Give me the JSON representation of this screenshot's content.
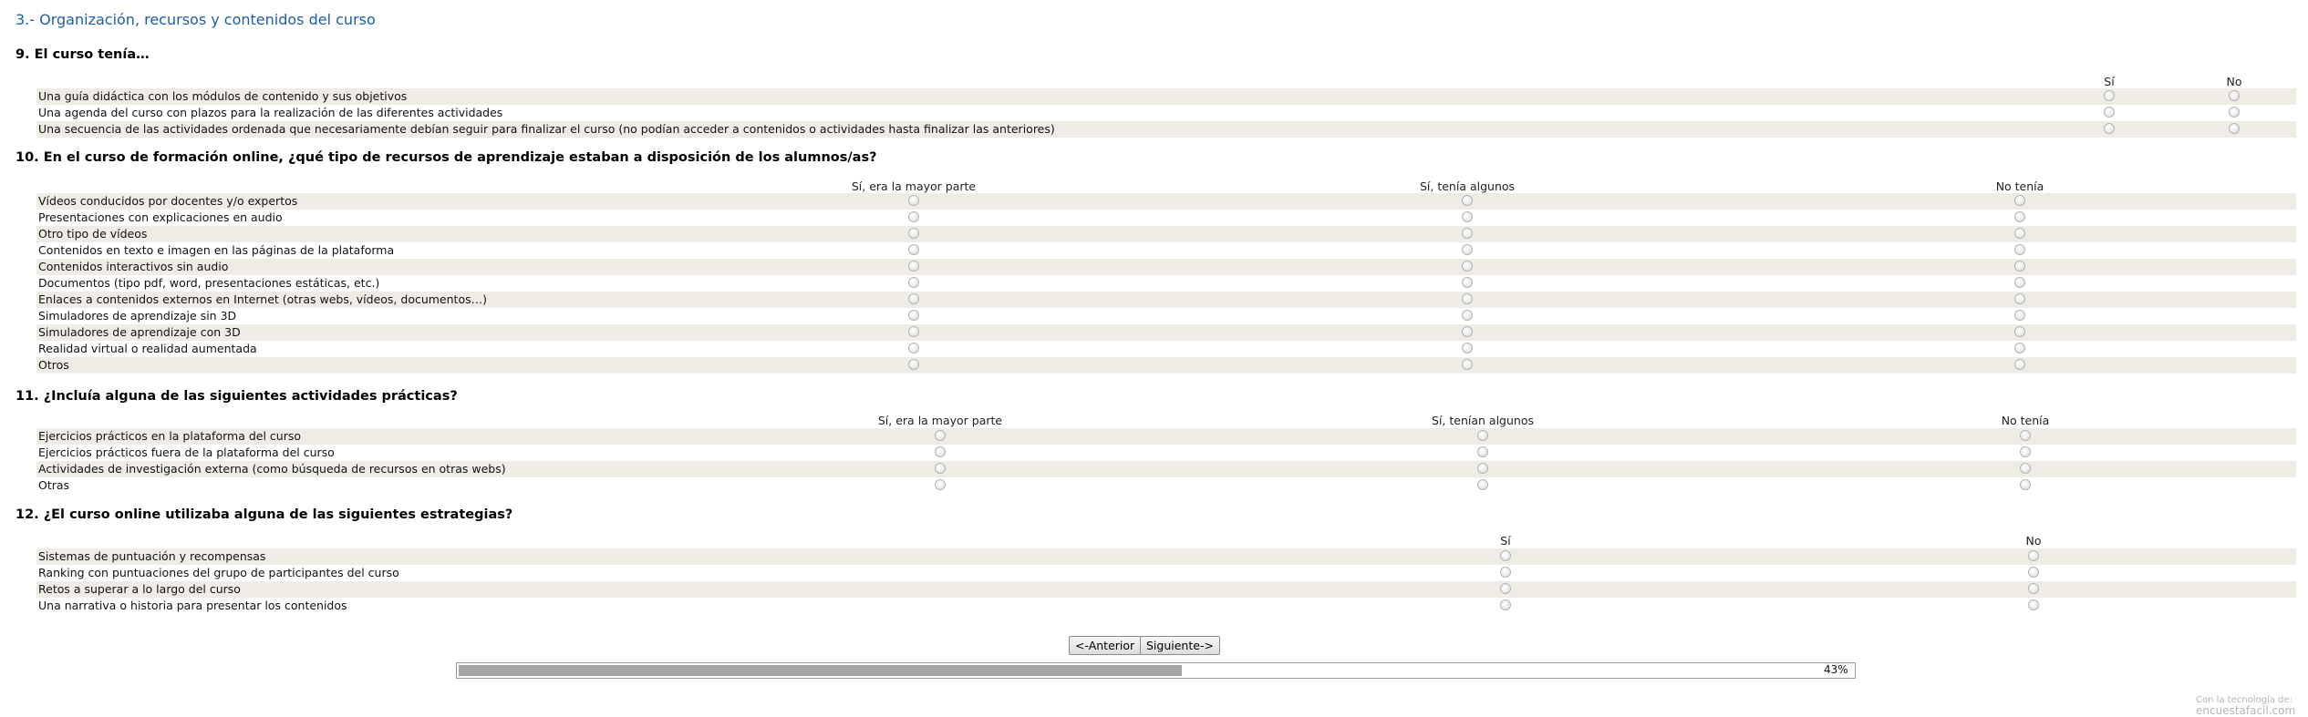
{
  "section": {
    "title": "3.- Organización, recursos y contenidos del curso"
  },
  "q9": {
    "title": "9. El curso tenía…",
    "columns": [
      "Sí",
      "No"
    ],
    "rows": [
      "Una guía didáctica con los módulos de contenido y sus objetivos",
      "Una agenda del curso con plazos para la realización de las diferentes actividades",
      "Una secuencia de las actividades ordenada que necesariamente debían seguir para finalizar el curso (no podían acceder a contenidos o actividades hasta finalizar las anteriores)"
    ]
  },
  "q10": {
    "title": "10. En el curso de formación online, ¿qué tipo de recursos de aprendizaje estaban a disposición de los alumnos/as?",
    "columns": [
      "Sí, era la mayor parte",
      "Sí, tenía algunos",
      "No tenía"
    ],
    "rows": [
      "Vídeos conducidos por docentes y/o expertos",
      "Presentaciones con explicaciones en audio",
      "Otro tipo de vídeos",
      "Contenidos en texto e imagen en las páginas de la plataforma",
      "Contenidos interactivos sin audio",
      "Documentos (tipo pdf, word, presentaciones estáticas, etc.)",
      "Enlaces a contenidos externos en Internet (otras webs, vídeos, documentos…)",
      "Simuladores de aprendizaje sin 3D",
      "Simuladores de aprendizaje con 3D",
      "Realidad virtual o realidad aumentada",
      "Otros"
    ]
  },
  "q11": {
    "title": "11. ¿Incluía alguna de las siguientes actividades prácticas?",
    "columns": [
      "Sí, era la mayor parte",
      "Sí, tenían algunos",
      "No tenía"
    ],
    "rows": [
      "Ejercicios prácticos en la plataforma del curso",
      "Ejercicios prácticos fuera de la plataforma del curso",
      "Actividades de investigación externa (como búsqueda de recursos en otras webs)",
      "Otras"
    ]
  },
  "q12": {
    "title": "12. ¿El curso online utilizaba alguna de las siguientes estrategias?",
    "columns": [
      "Sí",
      "No"
    ],
    "rows": [
      "Sistemas de puntuación y recompensas",
      "Ranking con puntuaciones del grupo de participantes del curso",
      "Retos a superar a lo largo del curso",
      "Una narrativa o historia para presentar los contenidos"
    ]
  },
  "nav": {
    "prev_label": "<-Anterior",
    "next_label": "Siguiente->"
  },
  "progress": {
    "value": 0.43,
    "label": "43%"
  },
  "footer": {
    "credit": "Con la tecnología de:",
    "brand": "encuestafacil.com"
  },
  "colors": {
    "title_blue": "#1d5ea8",
    "row_shade": "#efece6",
    "progress_fill": "#a6a6a6"
  }
}
